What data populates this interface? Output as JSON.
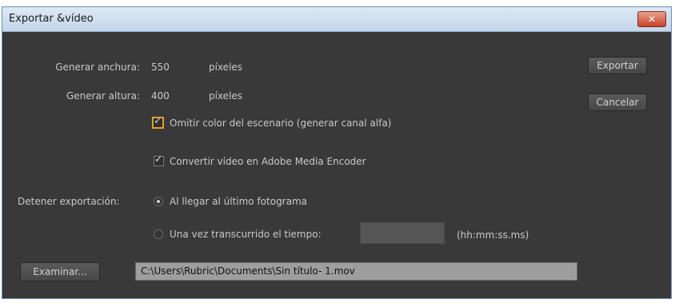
{
  "window": {
    "title": "Exportar &vídeo",
    "close_label": "✕"
  },
  "dimensions": {
    "width_label": "Generar anchura:",
    "width_value": "550",
    "width_unit": "píxeles",
    "height_label": "Generar altura:",
    "height_value": "400",
    "height_unit": "píxeles"
  },
  "options": {
    "omit_color_label": "Omitir color del escenario (generar canal alfa)",
    "omit_color_checked": true,
    "convert_label": "Convertir vídeo en Adobe Media Encoder",
    "convert_checked": true
  },
  "stop_export": {
    "label": "Detener exportación:",
    "option_last_frame": "Al llegar al último fotograma",
    "option_time": "Una vez transcurrido el tiempo:",
    "time_value": "",
    "time_format": "(hh:mm:ss.ms)",
    "selected": "last_frame"
  },
  "buttons": {
    "export": "Exportar",
    "cancel": "Cancelar",
    "browse": "Examinar..."
  },
  "path": {
    "value": "C:\\Users\\Rubric\\Documents\\Sin título- 1.mov"
  },
  "colors": {
    "panel_bg": "#393939",
    "focus_accent": "#e0a030",
    "titlebar": "#c3d6ea",
    "close_button": "#c8412a"
  }
}
